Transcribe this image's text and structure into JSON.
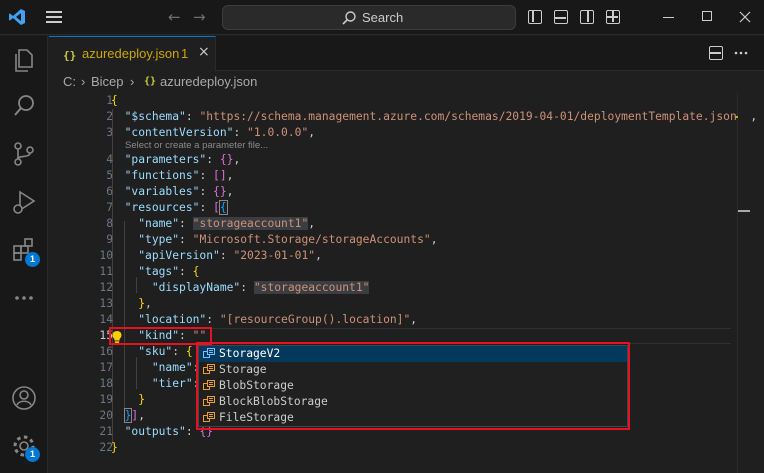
{
  "titlebar": {
    "search_label": "Search",
    "back_arrow": "←",
    "forward_arrow": "→",
    "minimize": "—",
    "maximize": "☐",
    "close": "✕"
  },
  "activitybar": {
    "extensions_badge": "1",
    "settings_badge": "1"
  },
  "tab": {
    "icon": "{}",
    "label": "azuredeploy.json",
    "problem_count": "1",
    "close": "×"
  },
  "breadcrumb": {
    "items": [
      "C:",
      "Bicep",
      "azuredeploy.json"
    ],
    "separator": "›",
    "file_icon": "{}"
  },
  "editor": {
    "line_numbers": [
      "1",
      "2",
      "3",
      "4",
      "5",
      "6",
      "7",
      "8",
      "9",
      "10",
      "11",
      "12",
      "13",
      "14",
      "15",
      "16",
      "17",
      "18",
      "19",
      "20",
      "21",
      "22"
    ],
    "active_line": "15",
    "codelens": "Select or create a parameter file...",
    "code": {
      "schema_key": "\"$schema\"",
      "schema_val": "\"https://schema.management.azure.com/schemas/2019-04-01/deploymentTemplate.json#\"",
      "cv_key": "\"contentVersion\"",
      "cv_val": "\"1.0.0.0\"",
      "params_key": "\"parameters\"",
      "functions_key": "\"functions\"",
      "variables_key": "\"variables\"",
      "resources_key": "\"resources\"",
      "name_key": "\"name\"",
      "name_val": "\"storageaccount1\"",
      "type_key": "\"type\"",
      "type_val": "\"Microsoft.Storage/storageAccounts\"",
      "api_key": "\"apiVersion\"",
      "api_val": "\"2023-01-01\"",
      "tags_key": "\"tags\"",
      "display_key": "\"displayName\"",
      "display_val": "\"storageaccount1\"",
      "location_key": "\"location\"",
      "location_val": "\"[resourceGroup().location]\"",
      "kind_key": "\"kind\"",
      "kind_val": "\"\"",
      "sku_key": "\"sku\"",
      "sku_name_key": "\"name\"",
      "sku_tier_key": "\"tier\"",
      "outputs_key": "\"outputs\""
    }
  },
  "suggestions": {
    "items": [
      "StorageV2",
      "Storage",
      "BlobStorage",
      "BlockBlobStorage",
      "FileStorage"
    ],
    "selected": "StorageV2"
  },
  "colors": {
    "accent": "#0078d4",
    "highlight_box": "#e81123",
    "warning": "#cca700"
  },
  "icons": {
    "logo": "vscode-logo-icon",
    "menu": "hamburger-menu-icon",
    "search": "search-icon",
    "explorer": "files-icon",
    "search_view": "search-icon",
    "scm": "source-control-icon",
    "run": "run-debug-icon",
    "extensions": "extensions-icon",
    "more": "ellipsis-icon",
    "account": "account-icon",
    "manage": "gear-icon",
    "lightbulb": "lightbulb-icon",
    "enum": "enum-member-icon"
  }
}
